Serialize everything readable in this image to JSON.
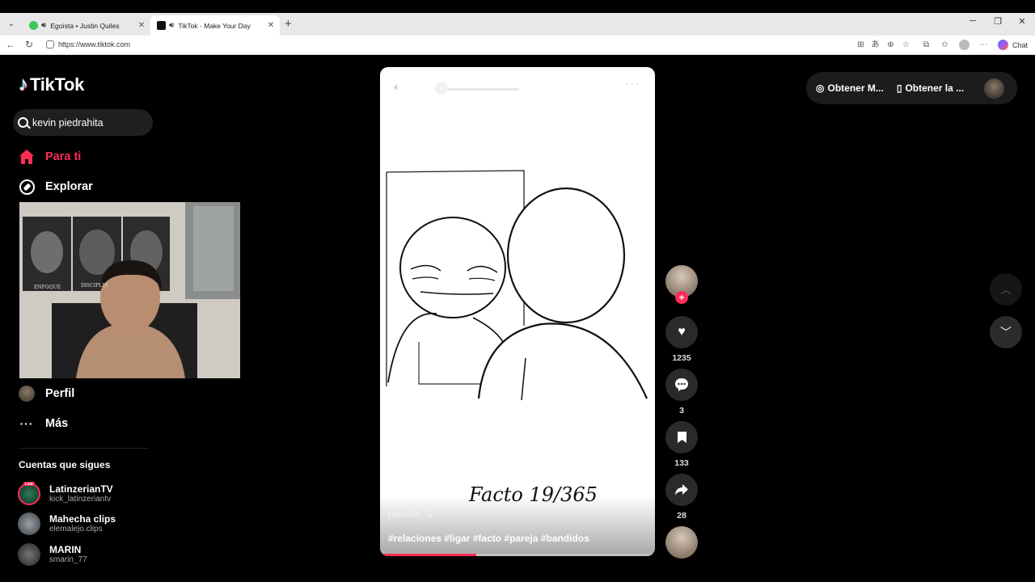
{
  "browser": {
    "tabs": [
      {
        "title": "Egoísta • Justin Quiles",
        "audible": true,
        "active": false
      },
      {
        "title": "TikTok - Make Your Day",
        "audible": true,
        "active": true
      }
    ],
    "url": "https://www.tiktok.com",
    "chat_label": "Chat"
  },
  "sidebar": {
    "logo_text": "TikTok",
    "search_value": "kevin piedrahita",
    "nav": [
      {
        "label": "Para ti",
        "icon": "home-icon",
        "active": true
      },
      {
        "label": "Explorar",
        "icon": "compass-icon",
        "active": false
      },
      {
        "label": "Perfil",
        "icon": "avatar",
        "active": false
      },
      {
        "label": "Más",
        "icon": "more-icon",
        "active": false
      }
    ],
    "following_header": "Cuentas que sigues",
    "accounts": [
      {
        "name": "LatinzerianTV",
        "handle": "kick_latinzeriantv",
        "live": true,
        "live_label": "LIVE"
      },
      {
        "name": "Mahecha clips",
        "handle": "elemalejo.clips",
        "live": false
      },
      {
        "name": "MARIN",
        "handle": "smarin_77",
        "live": false
      }
    ]
  },
  "webcam": {
    "poster_labels": [
      "ENFOQUE",
      "DISCIPLIN"
    ]
  },
  "video": {
    "author": "jacobfr_1",
    "description": "#relaciones #ligar #facto #pareja #bandidos",
    "caption_art": "Facto 19/365",
    "progress": 0.35
  },
  "actions": {
    "likes": "1235",
    "comments": "3",
    "saves": "133",
    "shares": "28"
  },
  "topright": {
    "get_coins": "Obtener M...",
    "get_app": "Obtener la ..."
  },
  "colors": {
    "accent": "#fe2c55",
    "background": "#000000"
  }
}
